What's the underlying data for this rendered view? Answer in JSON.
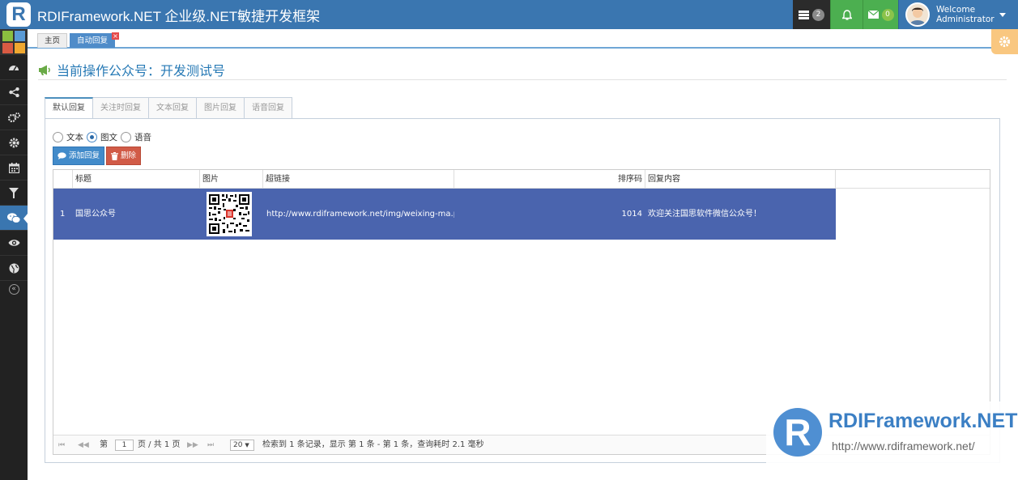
{
  "navbar": {
    "logo_letter": "R",
    "app_title": "RDIFramework.NET 企业级.NET敏捷开发框架",
    "tasks_count": "2",
    "messages_count": "0",
    "welcome": "Welcome",
    "username": "Administrator"
  },
  "sidebar": {
    "shortcut_colors": [
      "#8bbf3f",
      "#5a9bd6",
      "#d95b43",
      "#f0a830"
    ],
    "items": [
      {
        "name": "dashboard",
        "icon": "tachometer-icon"
      },
      {
        "name": "share",
        "icon": "share-icon"
      },
      {
        "name": "cogs",
        "icon": "cogs-icon"
      },
      {
        "name": "settings",
        "icon": "gear-icon"
      },
      {
        "name": "calendar",
        "icon": "calendar-icon"
      },
      {
        "name": "filter",
        "icon": "filter-icon"
      },
      {
        "name": "wechat",
        "icon": "wechat-icon",
        "active": true
      },
      {
        "name": "eye",
        "icon": "eye-icon"
      },
      {
        "name": "globe",
        "icon": "globe-icon"
      }
    ]
  },
  "tabs": {
    "home": "主页",
    "current": "自动回复"
  },
  "page": {
    "title": "当前操作公众号：开发测试号"
  },
  "content_tabs": [
    "默认回复",
    "关注时回复",
    "文本回复",
    "图片回复",
    "语音回复"
  ],
  "reply_type": {
    "options": [
      "文本",
      "图文",
      "语音"
    ],
    "selected": "图文"
  },
  "toolbar": {
    "add_label": "添加回复",
    "delete_label": "删除"
  },
  "grid": {
    "columns": [
      "标题",
      "图片",
      "超链接",
      "排序码",
      "回复内容"
    ],
    "rows": [
      {
        "index": "1",
        "title": "国思公众号",
        "link": "http://www.rdiframework.net/img/weixing-ma.png",
        "sort": "1014",
        "content": "欢迎关注国思软件微信公众号！"
      }
    ]
  },
  "pager": {
    "page_prefix": "第",
    "page_value": "1",
    "page_suffix": "页 / 共 1 页",
    "page_size": "20",
    "summary": "检索到 1 条记录，显示 第 1 条 - 第 1 条，查询耗时 2.1 毫秒"
  },
  "watermark": {
    "logo_letter": "R",
    "name": "RDIFramework.NET",
    "url": "http://www.rdiframework.net/"
  }
}
